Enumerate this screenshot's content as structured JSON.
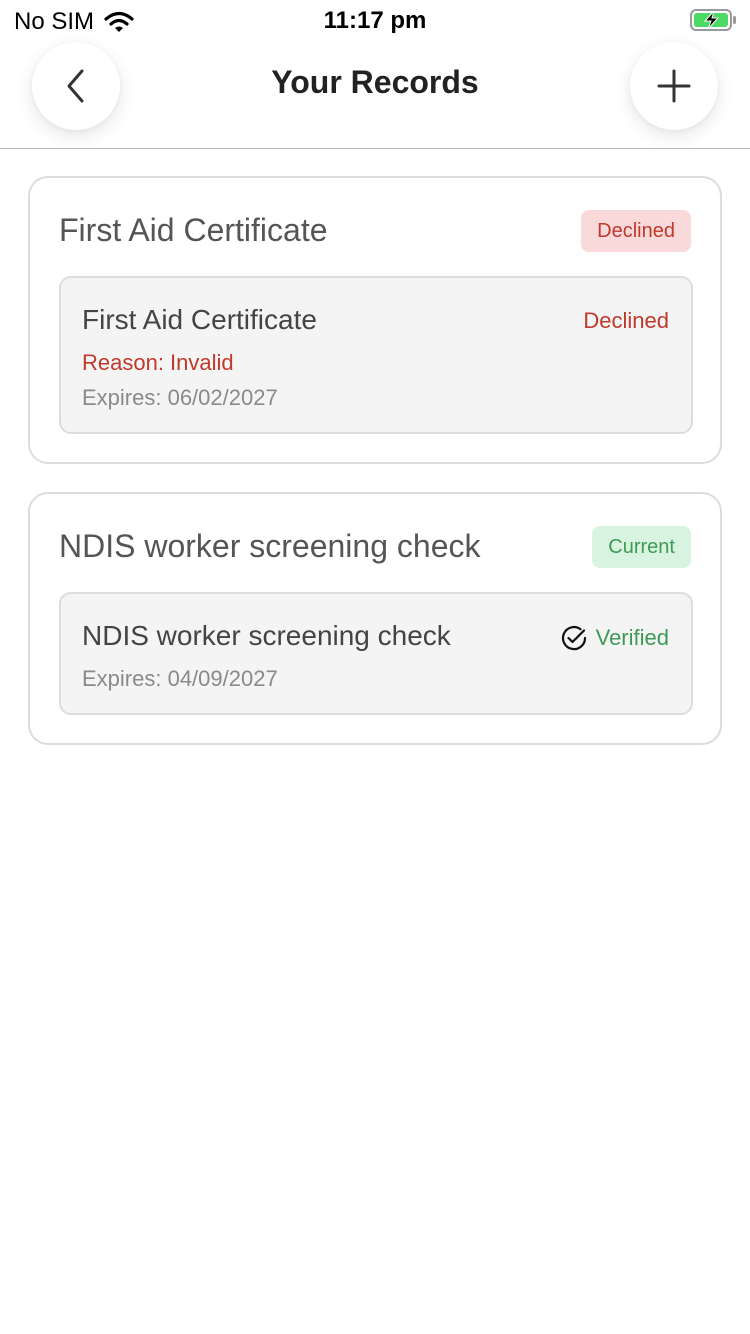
{
  "status_bar": {
    "carrier": "No SIM",
    "time": "11:17 pm"
  },
  "header": {
    "title": "Your Records",
    "back_icon": "chevron-left-icon",
    "add_icon": "plus-icon"
  },
  "records": [
    {
      "title": "First Aid Certificate",
      "badge": "Declined",
      "item": {
        "title": "First Aid Certificate",
        "status": "Declined",
        "reason": "Reason: Invalid",
        "expires": "Expires: 06/02/2027"
      }
    },
    {
      "title": "NDIS worker screening check",
      "badge": "Current",
      "item": {
        "title": "NDIS worker screening check",
        "status": "Verified",
        "status_icon": "check-circle-icon",
        "expires": "Expires: 04/09/2027"
      }
    }
  ],
  "colors": {
    "declined_text": "#c0392b",
    "declined_bg": "#f9d9d9",
    "current_text": "#3e9a55",
    "current_bg": "#d8f3df",
    "battery_green": "#4cd964"
  }
}
